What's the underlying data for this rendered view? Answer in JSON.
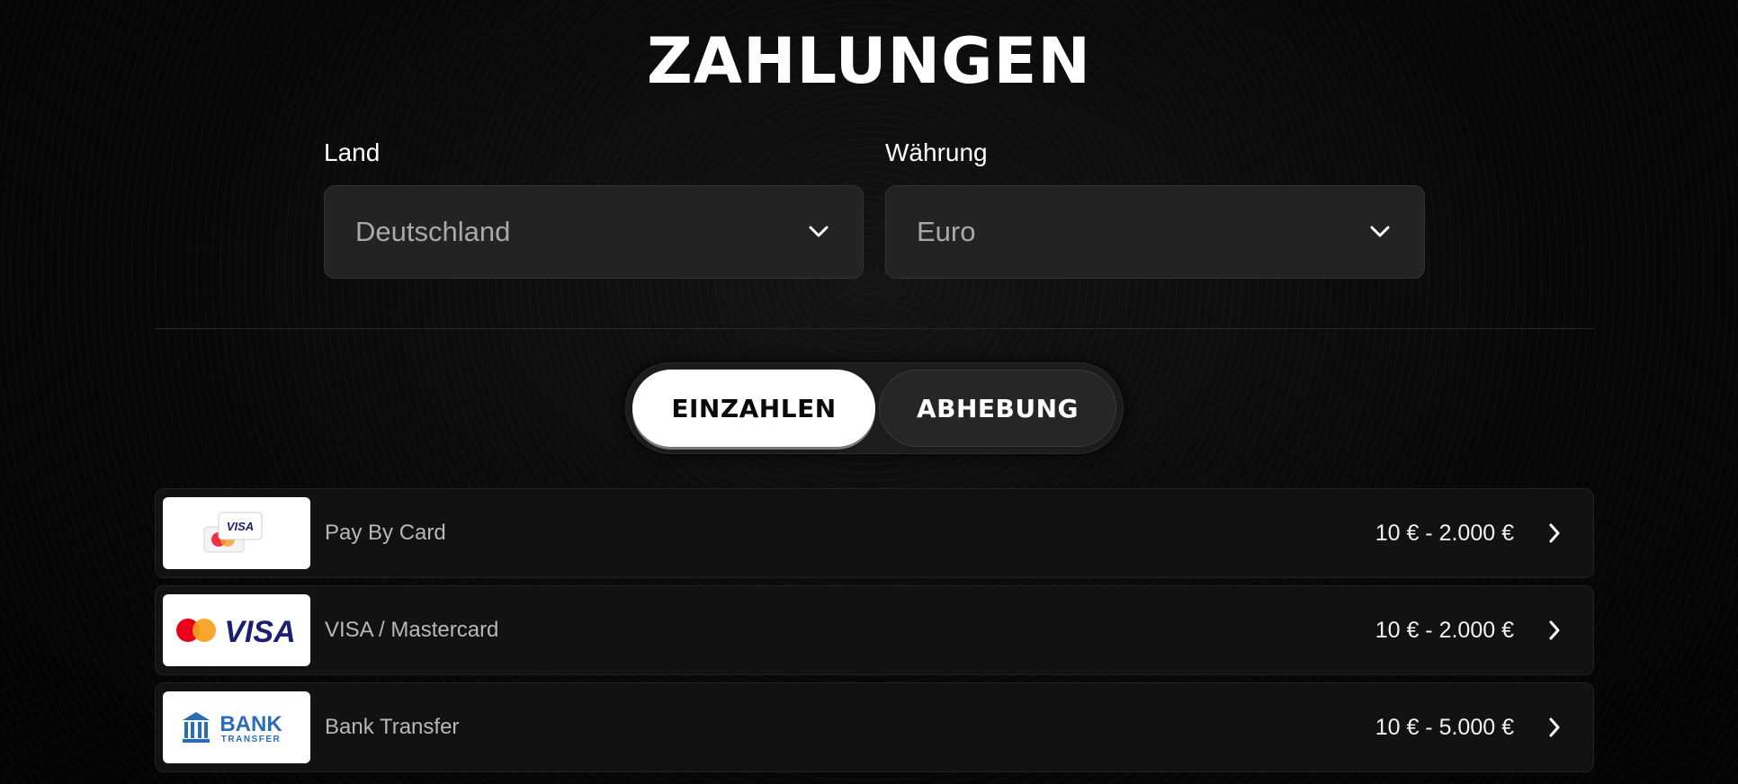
{
  "page": {
    "title": "ZAHLUNGEN"
  },
  "filters": {
    "country": {
      "label": "Land",
      "value": "Deutschland",
      "icon": "chevron-down-icon"
    },
    "currency": {
      "label": "Währung",
      "value": "Euro",
      "icon": "chevron-down-icon"
    }
  },
  "tabs": [
    {
      "label": "EINZAHLEN",
      "active": true
    },
    {
      "label": "ABHEBUNG",
      "active": false
    }
  ],
  "methods": [
    {
      "name": "Pay By Card",
      "range": "10 € - 2.000 €",
      "logo": "card-stack-logo",
      "icon": "chevron-right-icon"
    },
    {
      "name": "VISA / Mastercard",
      "range": "10 € - 2.000 €",
      "logo": "visa-mastercard-logo",
      "logo_text": "VISA",
      "icon": "chevron-right-icon"
    },
    {
      "name": "Bank Transfer",
      "range": "10 € - 5.000 €",
      "logo": "bank-transfer-logo",
      "logo_text": "BANK",
      "logo_subtext": "TRANSFER",
      "icon": "chevron-right-icon"
    }
  ],
  "colors": {
    "background": "#050505",
    "select_bg": "#232323",
    "row_bg": "#121212",
    "visa_blue": "#1a1f71",
    "mastercard_red": "#eb001b",
    "mastercard_orange": "#f79e1b",
    "bank_blue": "#2a6db5"
  }
}
